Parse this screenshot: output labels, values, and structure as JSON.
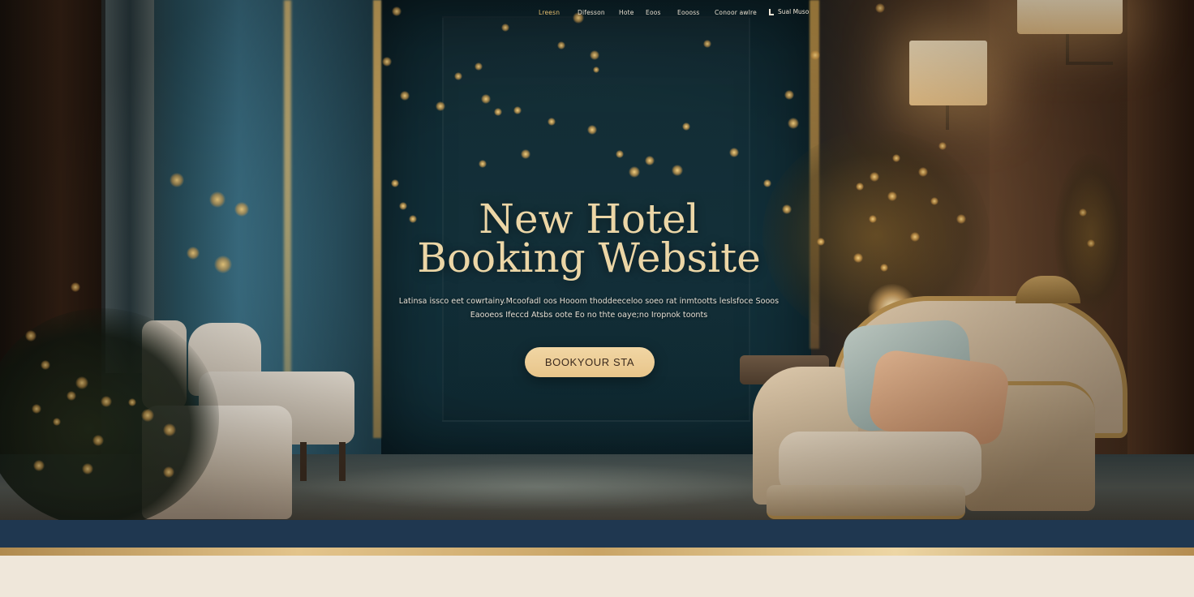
{
  "nav": {
    "items": [
      {
        "label": "Lreesn",
        "active": true
      },
      {
        "label": "Difesson",
        "active": false
      },
      {
        "label": "Hote",
        "active": false
      },
      {
        "label": "Eoos",
        "active": false
      },
      {
        "label": "Eoooss",
        "active": false
      },
      {
        "label": "Conoor awlre",
        "active": false
      }
    ],
    "login": {
      "label": "Sual Muso",
      "icon": "user-icon"
    }
  },
  "hero": {
    "title_line1": "New Hotel",
    "title_line2": "Booking Website",
    "subtitle_line1": "Latinsa issco eet cowrtainy.Mcoofadl oos Hooom thoddeeceloo soeo rat inmtootts leslsfoce Sooos",
    "subtitle_line2": "Eaooeos Ifeccd Atsbs oote Eo no thte oaye;no Iropnok toonts",
    "cta_label": "BOOKYOUR STA"
  },
  "colors": {
    "accent_gold": "#e7bf6f",
    "title_color": "#ecd6a6",
    "cta_background": "#ecce98",
    "navy_band": "#1f3750",
    "cream_band": "#efe7da"
  }
}
